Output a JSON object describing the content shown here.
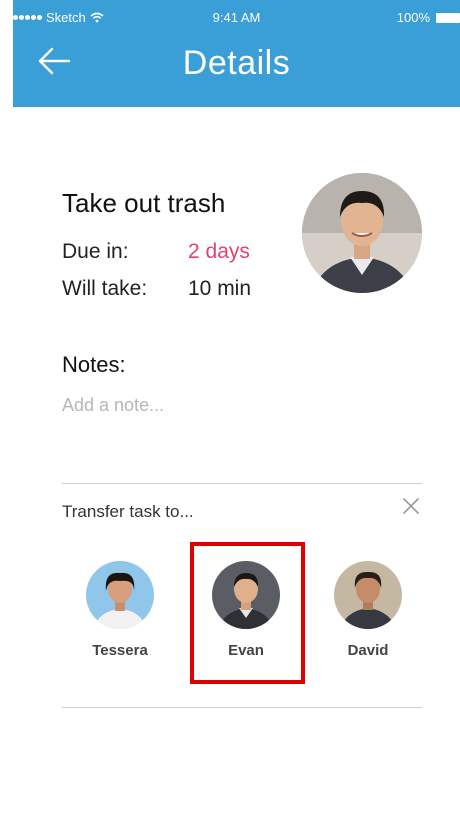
{
  "status_bar": {
    "carrier": "Sketch",
    "time": "9:41 AM",
    "battery": "100%"
  },
  "header": {
    "title": "Details",
    "icon": "back-arrow-icon"
  },
  "task": {
    "title": "Take out trash",
    "due_label": "Due in:",
    "due_value": "2 days",
    "duration_label": "Will take:",
    "duration_value": "10 min",
    "assignee_avatar": "avatar-photo"
  },
  "notes": {
    "label": "Notes:",
    "placeholder": "Add a note..."
  },
  "transfer": {
    "label": "Transfer task to...",
    "close_icon": "close-icon",
    "people": [
      {
        "name": "Tessera"
      },
      {
        "name": "Evan",
        "selected": true
      },
      {
        "name": "David"
      }
    ]
  },
  "colors": {
    "header": "#3a9fd6",
    "due_accent": "#e0446c",
    "selection": "#e00000"
  }
}
